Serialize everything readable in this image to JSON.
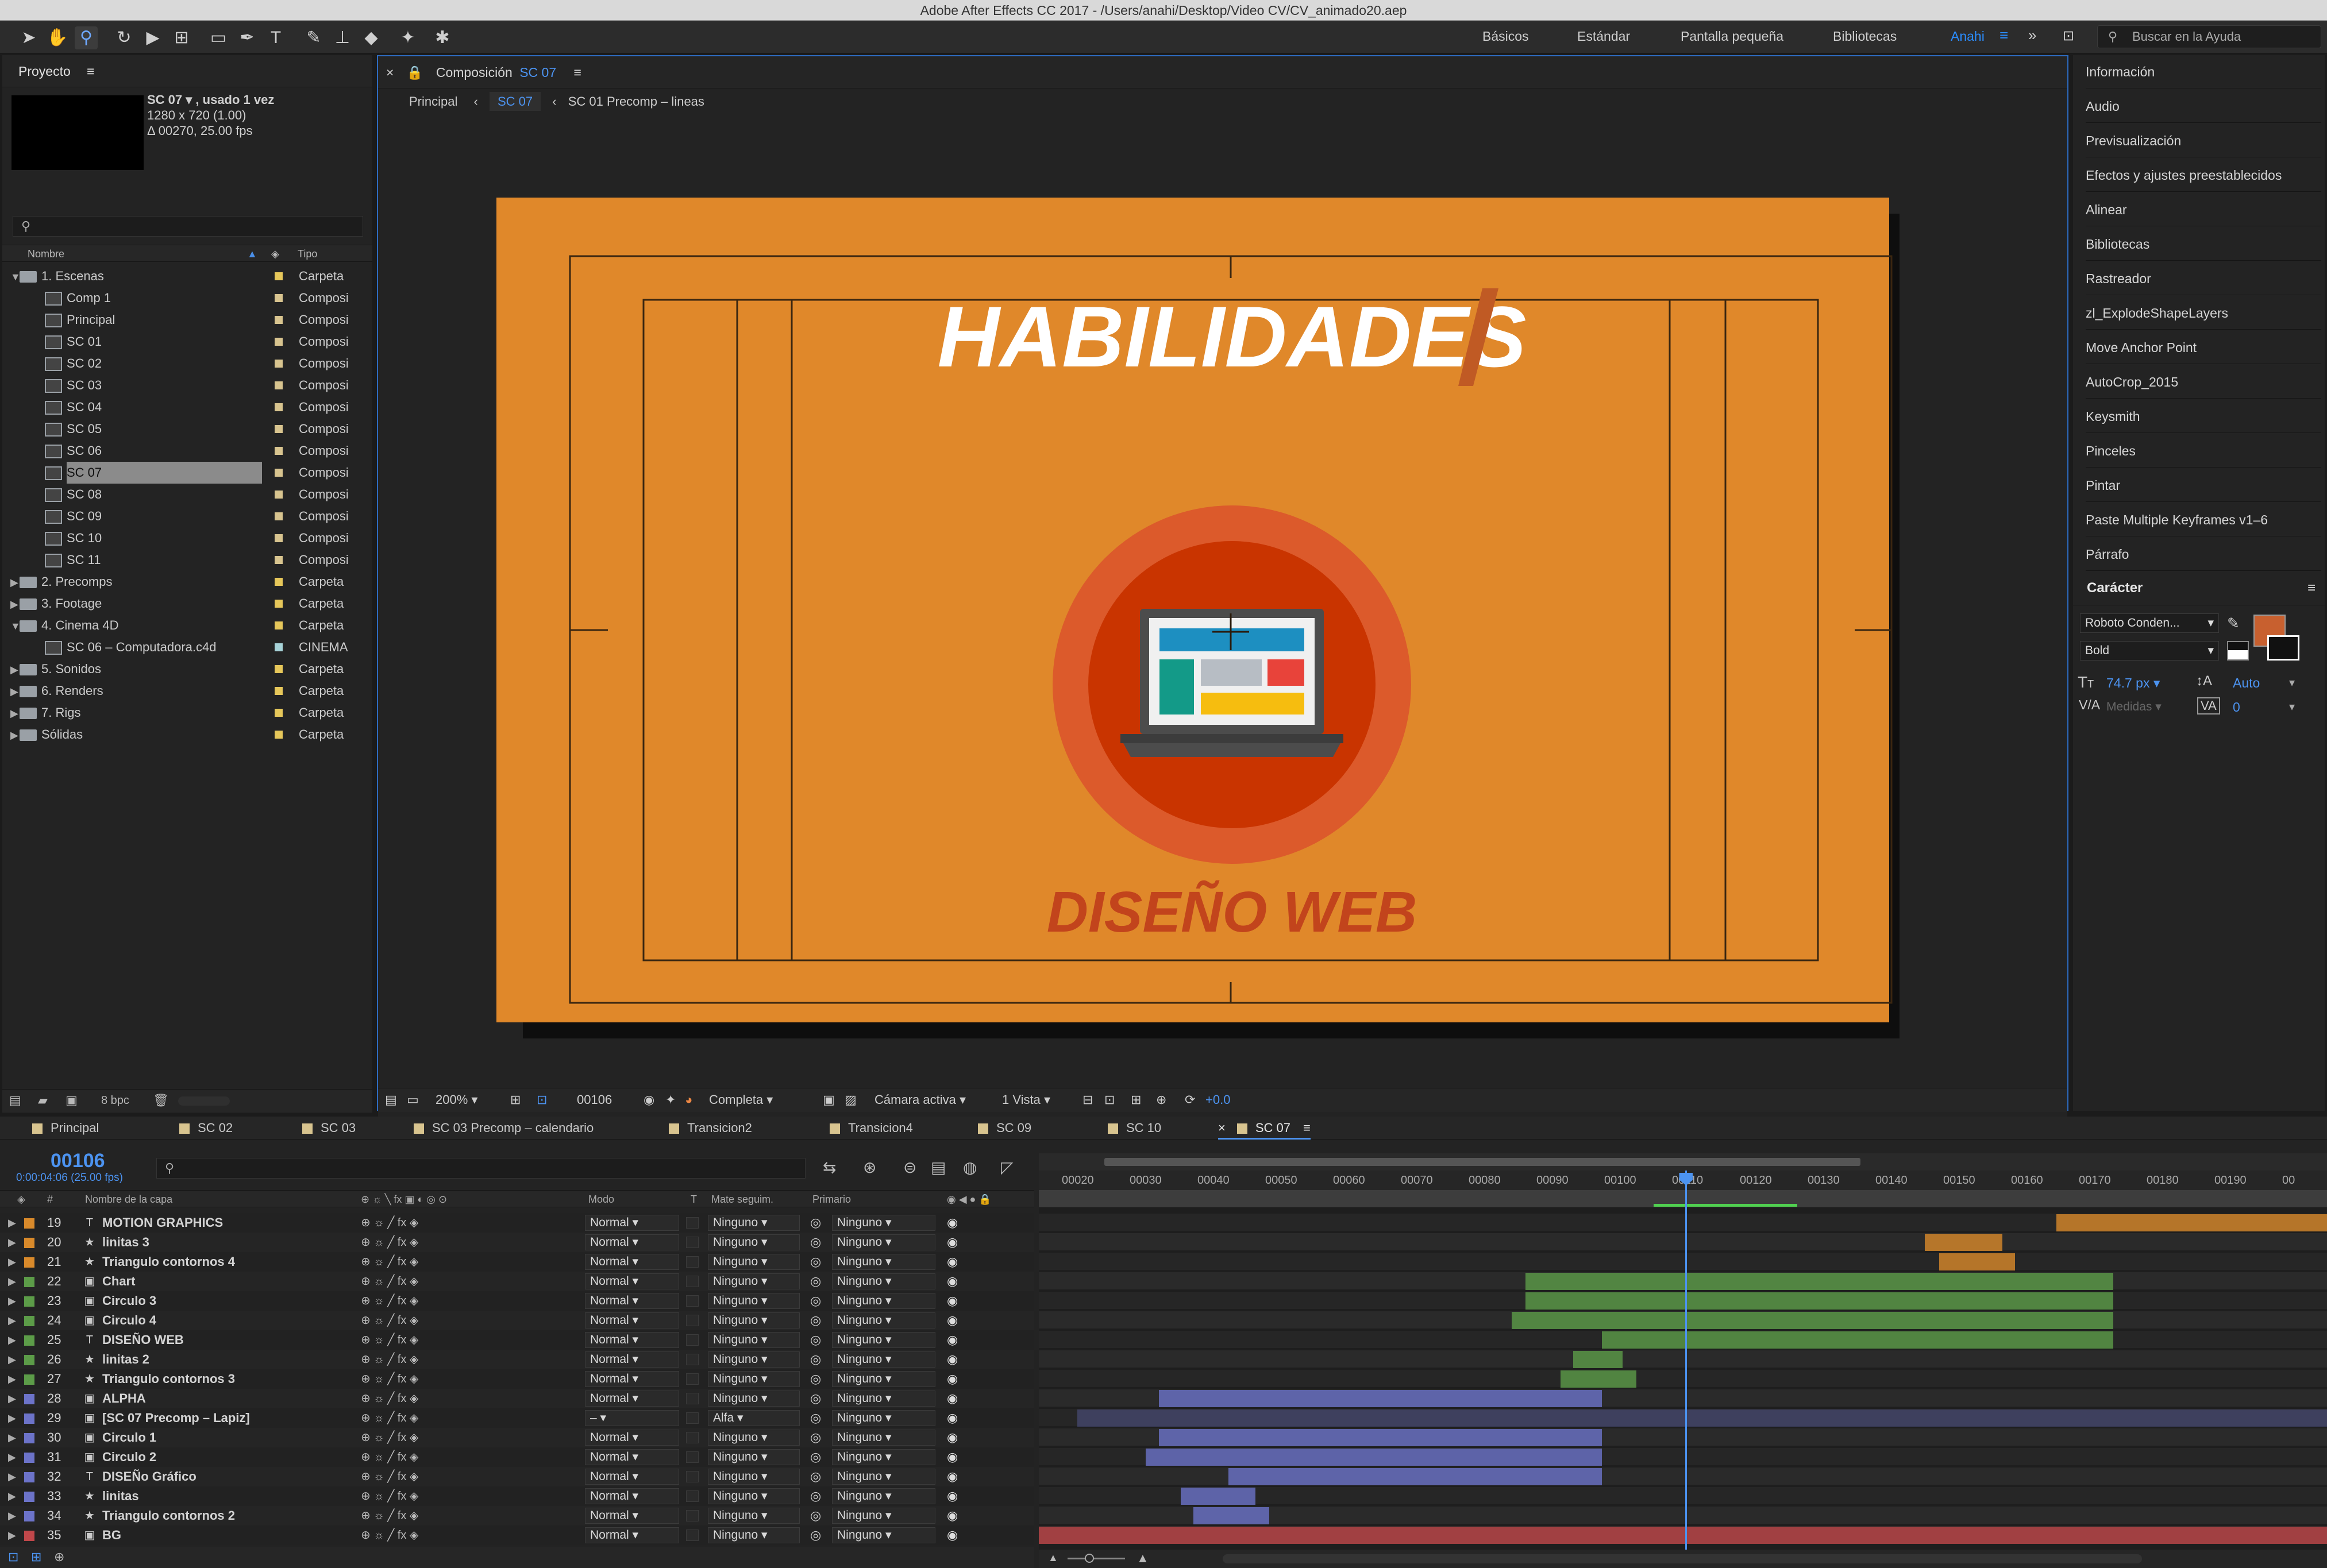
{
  "window": {
    "title": "Adobe After Effects CC 2017 - /Users/anahi/Desktop/Video CV/CV_animado20.aep"
  },
  "workspaces": [
    "Básicos",
    "Estándar",
    "Pantalla pequeña",
    "Bibliotecas",
    "Anahi"
  ],
  "help_placeholder": "Buscar en la Ayuda",
  "project": {
    "panel_title": "Proyecto",
    "selected_name": "SC 07 ▾ , usado 1 vez",
    "selected_size": "1280 x 720 (1.00)",
    "selected_duration": "Δ 00270, 25.00 fps",
    "col_name": "Nombre",
    "col_type": "Tipo",
    "bpc": "8 bpc",
    "items": [
      {
        "name": "1. Escenas",
        "type": "Carpeta",
        "kind": "folder",
        "indent": 0,
        "arrow": "▼",
        "color": "#e6c75a"
      },
      {
        "name": "Comp 1",
        "type": "Composi",
        "kind": "comp",
        "indent": 1,
        "color": "#d8c48f"
      },
      {
        "name": "Principal",
        "type": "Composi",
        "kind": "comp",
        "indent": 1,
        "color": "#d8c48f"
      },
      {
        "name": "SC 01",
        "type": "Composi",
        "kind": "comp",
        "indent": 1,
        "color": "#d8c48f"
      },
      {
        "name": "SC 02",
        "type": "Composi",
        "kind": "comp",
        "indent": 1,
        "color": "#d8c48f"
      },
      {
        "name": "SC 03",
        "type": "Composi",
        "kind": "comp",
        "indent": 1,
        "color": "#d8c48f"
      },
      {
        "name": "SC 04",
        "type": "Composi",
        "kind": "comp",
        "indent": 1,
        "color": "#d8c48f"
      },
      {
        "name": "SC 05",
        "type": "Composi",
        "kind": "comp",
        "indent": 1,
        "color": "#d8c48f"
      },
      {
        "name": "SC 06",
        "type": "Composi",
        "kind": "comp",
        "indent": 1,
        "color": "#d8c48f"
      },
      {
        "name": "SC 07",
        "type": "Composi",
        "kind": "comp",
        "indent": 1,
        "color": "#d8c48f",
        "selected": true
      },
      {
        "name": "SC 08",
        "type": "Composi",
        "kind": "comp",
        "indent": 1,
        "color": "#d8c48f"
      },
      {
        "name": "SC 09",
        "type": "Composi",
        "kind": "comp",
        "indent": 1,
        "color": "#d8c48f"
      },
      {
        "name": "SC 10",
        "type": "Composi",
        "kind": "comp",
        "indent": 1,
        "color": "#d8c48f"
      },
      {
        "name": "SC 11",
        "type": "Composi",
        "kind": "comp",
        "indent": 1,
        "color": "#d8c48f"
      },
      {
        "name": "2. Precomps",
        "type": "Carpeta",
        "kind": "folder",
        "indent": 0,
        "arrow": "▶",
        "color": "#e6c75a"
      },
      {
        "name": "3. Footage",
        "type": "Carpeta",
        "kind": "folder",
        "indent": 0,
        "arrow": "▶",
        "color": "#e6c75a"
      },
      {
        "name": "4. Cinema 4D",
        "type": "Carpeta",
        "kind": "folder",
        "indent": 0,
        "arrow": "▼",
        "color": "#e6c75a"
      },
      {
        "name": "SC 06 – Computadora.c4d",
        "type": "CINEMA",
        "kind": "file",
        "indent": 1,
        "color": "#a7d3d8"
      },
      {
        "name": "5. Sonidos",
        "type": "Carpeta",
        "kind": "folder",
        "indent": 0,
        "arrow": "▶",
        "color": "#e6c75a"
      },
      {
        "name": "6. Renders",
        "type": "Carpeta",
        "kind": "folder",
        "indent": 0,
        "arrow": "▶",
        "color": "#e6c75a"
      },
      {
        "name": "7. Rigs",
        "type": "Carpeta",
        "kind": "folder",
        "indent": 0,
        "arrow": "▶",
        "color": "#e6c75a"
      },
      {
        "name": "Sólidas",
        "type": "Carpeta",
        "kind": "folder",
        "indent": 0,
        "arrow": "▶",
        "color": "#e6c75a"
      }
    ]
  },
  "composition": {
    "panel_prefix": "Composición",
    "panel_name": "SC 07",
    "breadcrumbs": [
      "Principal",
      "SC 07",
      "SC 01 Precomp – lineas"
    ],
    "title_text": "HABILIDADES",
    "subtitle_text": "DISEÑO WEB",
    "bg_color": "#e0882a",
    "circle_outer": "#dc5a2b",
    "circle_inner": "#c93400",
    "zoom": "200%",
    "frame": "00106",
    "resolution": "Completa",
    "camera": "Cámara activa",
    "views": "1 Vista",
    "exposure": "+0.0"
  },
  "right_panel": {
    "items": [
      "Información",
      "Audio",
      "Previsualización",
      "Efectos y ajustes preestablecidos",
      "Alinear",
      "Bibliotecas",
      "Rastreador",
      "zl_ExplodeShapeLayers",
      "Move Anchor Point",
      "AutoCrop_2015",
      "Keysmith",
      "Pinceles",
      "Pintar",
      "Paste Multiple Keyframes v1–6",
      "Párrafo"
    ],
    "character_title": "Carácter",
    "font_family": "Roboto Conden...",
    "font_style": "Bold",
    "font_size": "74.7 px",
    "leading": "Auto",
    "kerning": "Medidas",
    "tracking": "0",
    "fill_color": "#c8602f"
  },
  "timeline": {
    "tabs": [
      {
        "label": "Principal",
        "color": "#d8c48f"
      },
      {
        "label": "SC 02",
        "color": "#d8c48f"
      },
      {
        "label": "SC 03",
        "color": "#d8c48f"
      },
      {
        "label": "SC 03 Precomp – calendario",
        "color": "#d8c48f"
      },
      {
        "label": "Transicion2",
        "color": "#d8c48f"
      },
      {
        "label": "Transicion4",
        "color": "#d8c48f"
      },
      {
        "label": "SC 09",
        "color": "#d8c48f"
      },
      {
        "label": "SC 10",
        "color": "#d8c48f"
      },
      {
        "label": "SC 07",
        "color": "#d8c48f",
        "active": true
      }
    ],
    "current_frame": "00106",
    "current_time": "0:00:04:06 (25.00 fps)",
    "col_layer_name": "Nombre de la capa",
    "col_mode": "Modo",
    "col_t": "T",
    "col_matte": "Mate seguim.",
    "col_parent": "Primario",
    "ruler": [
      "00020",
      "00030",
      "00040",
      "00050",
      "00060",
      "00070",
      "00080",
      "00090",
      "00100",
      "00110",
      "00120",
      "00130",
      "00140",
      "00150",
      "00160",
      "00170",
      "00180",
      "00190",
      "00"
    ],
    "layers": [
      {
        "num": "19",
        "name": "MOTION GRAPHICS",
        "icon": "T",
        "color": "#d98a2b",
        "mode": "Normal",
        "matte": "Ninguno",
        "parent": "Ninguno",
        "start": 0.79,
        "end": 1.0
      },
      {
        "num": "20",
        "name": "linitas 3",
        "icon": "★",
        "color": "#d98a2b",
        "mode": "Normal",
        "matte": "Ninguno",
        "parent": "Ninguno",
        "start": 0.688,
        "end": 0.748
      },
      {
        "num": "21",
        "name": "Triangulo contornos 4",
        "icon": "★",
        "color": "#d98a2b",
        "mode": "Normal",
        "matte": "Ninguno",
        "parent": "Ninguno",
        "start": 0.699,
        "end": 0.758
      },
      {
        "num": "22",
        "name": "Chart",
        "icon": "▣",
        "color": "#5c9c48",
        "mode": "Normal",
        "matte": "Ninguno",
        "parent": "Ninguno",
        "start": 0.378,
        "end": 0.834
      },
      {
        "num": "23",
        "name": "Circulo 3",
        "icon": "▣",
        "color": "#5c9c48",
        "mode": "Normal",
        "matte": "Ninguno",
        "parent": "Ninguno",
        "start": 0.378,
        "end": 0.834
      },
      {
        "num": "24",
        "name": "Circulo 4",
        "icon": "▣",
        "color": "#5c9c48",
        "mode": "Normal",
        "matte": "Ninguno",
        "parent": "Ninguno",
        "start": 0.367,
        "end": 0.834
      },
      {
        "num": "25",
        "name": "DISEÑO WEB",
        "icon": "T",
        "color": "#5c9c48",
        "mode": "Normal",
        "matte": "Ninguno",
        "parent": "Ninguno",
        "start": 0.437,
        "end": 0.834
      },
      {
        "num": "26",
        "name": "linitas 2",
        "icon": "★",
        "color": "#5c9c48",
        "mode": "Normal",
        "matte": "Ninguno",
        "parent": "Ninguno",
        "start": 0.415,
        "end": 0.453
      },
      {
        "num": "27",
        "name": "Triangulo contornos 3",
        "icon": "★",
        "color": "#5c9c48",
        "mode": "Normal",
        "matte": "Ninguno",
        "parent": "Ninguno",
        "start": 0.405,
        "end": 0.464
      },
      {
        "num": "28",
        "name": "ALPHA",
        "icon": "▣",
        "color": "#6c73c9",
        "mode": "Normal",
        "matte": "Ninguno",
        "parent": "Ninguno",
        "start": 0.093,
        "end": 0.437
      },
      {
        "num": "29",
        "name": "[SC 07 Precomp – Lapiz]",
        "icon": "▣",
        "color": "#6c73c9",
        "mode": "–",
        "matte": "Alfa",
        "parent": "Ninguno",
        "start": 0.03,
        "end": 1.0,
        "faded": true
      },
      {
        "num": "30",
        "name": "Circulo 1",
        "icon": "▣",
        "color": "#6c73c9",
        "mode": "Normal",
        "matte": "Ninguno",
        "parent": "Ninguno",
        "start": 0.093,
        "end": 0.437
      },
      {
        "num": "31",
        "name": "Circulo 2",
        "icon": "▣",
        "color": "#6c73c9",
        "mode": "Normal",
        "matte": "Ninguno",
        "parent": "Ninguno",
        "start": 0.083,
        "end": 0.437
      },
      {
        "num": "32",
        "name": "DISEÑo Gráfico",
        "icon": "T",
        "color": "#6c73c9",
        "mode": "Normal",
        "matte": "Ninguno",
        "parent": "Ninguno",
        "start": 0.147,
        "end": 0.437
      },
      {
        "num": "33",
        "name": "linitas",
        "icon": "★",
        "color": "#6c73c9",
        "mode": "Normal",
        "matte": "Ninguno",
        "parent": "Ninguno",
        "start": 0.11,
        "end": 0.168
      },
      {
        "num": "34",
        "name": "Triangulo contornos 2",
        "icon": "★",
        "color": "#6c73c9",
        "mode": "Normal",
        "matte": "Ninguno",
        "parent": "Ninguno",
        "start": 0.12,
        "end": 0.179
      },
      {
        "num": "35",
        "name": "BG",
        "icon": "▣",
        "color": "#c0474a",
        "mode": "Normal",
        "matte": "Ninguno",
        "parent": "Ninguno",
        "start": 0.0,
        "end": 1.0
      }
    ],
    "playhead": 0.502
  }
}
